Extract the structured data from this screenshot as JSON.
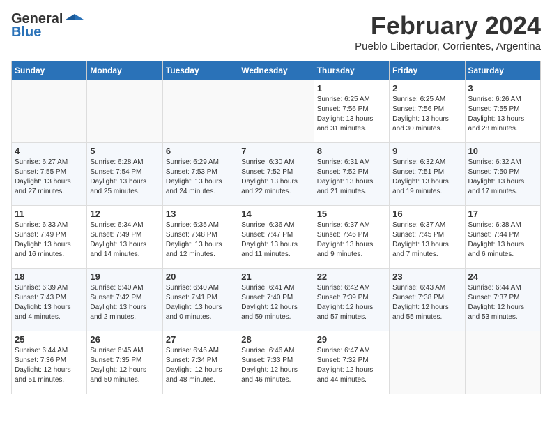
{
  "logo": {
    "general": "General",
    "blue": "Blue"
  },
  "title": {
    "month": "February 2024",
    "location": "Pueblo Libertador, Corrientes, Argentina"
  },
  "headers": [
    "Sunday",
    "Monday",
    "Tuesday",
    "Wednesday",
    "Thursday",
    "Friday",
    "Saturday"
  ],
  "weeks": [
    [
      {
        "day": "",
        "detail": ""
      },
      {
        "day": "",
        "detail": ""
      },
      {
        "day": "",
        "detail": ""
      },
      {
        "day": "",
        "detail": ""
      },
      {
        "day": "1",
        "detail": "Sunrise: 6:25 AM\nSunset: 7:56 PM\nDaylight: 13 hours\nand 31 minutes."
      },
      {
        "day": "2",
        "detail": "Sunrise: 6:25 AM\nSunset: 7:56 PM\nDaylight: 13 hours\nand 30 minutes."
      },
      {
        "day": "3",
        "detail": "Sunrise: 6:26 AM\nSunset: 7:55 PM\nDaylight: 13 hours\nand 28 minutes."
      }
    ],
    [
      {
        "day": "4",
        "detail": "Sunrise: 6:27 AM\nSunset: 7:55 PM\nDaylight: 13 hours\nand 27 minutes."
      },
      {
        "day": "5",
        "detail": "Sunrise: 6:28 AM\nSunset: 7:54 PM\nDaylight: 13 hours\nand 25 minutes."
      },
      {
        "day": "6",
        "detail": "Sunrise: 6:29 AM\nSunset: 7:53 PM\nDaylight: 13 hours\nand 24 minutes."
      },
      {
        "day": "7",
        "detail": "Sunrise: 6:30 AM\nSunset: 7:52 PM\nDaylight: 13 hours\nand 22 minutes."
      },
      {
        "day": "8",
        "detail": "Sunrise: 6:31 AM\nSunset: 7:52 PM\nDaylight: 13 hours\nand 21 minutes."
      },
      {
        "day": "9",
        "detail": "Sunrise: 6:32 AM\nSunset: 7:51 PM\nDaylight: 13 hours\nand 19 minutes."
      },
      {
        "day": "10",
        "detail": "Sunrise: 6:32 AM\nSunset: 7:50 PM\nDaylight: 13 hours\nand 17 minutes."
      }
    ],
    [
      {
        "day": "11",
        "detail": "Sunrise: 6:33 AM\nSunset: 7:49 PM\nDaylight: 13 hours\nand 16 minutes."
      },
      {
        "day": "12",
        "detail": "Sunrise: 6:34 AM\nSunset: 7:49 PM\nDaylight: 13 hours\nand 14 minutes."
      },
      {
        "day": "13",
        "detail": "Sunrise: 6:35 AM\nSunset: 7:48 PM\nDaylight: 13 hours\nand 12 minutes."
      },
      {
        "day": "14",
        "detail": "Sunrise: 6:36 AM\nSunset: 7:47 PM\nDaylight: 13 hours\nand 11 minutes."
      },
      {
        "day": "15",
        "detail": "Sunrise: 6:37 AM\nSunset: 7:46 PM\nDaylight: 13 hours\nand 9 minutes."
      },
      {
        "day": "16",
        "detail": "Sunrise: 6:37 AM\nSunset: 7:45 PM\nDaylight: 13 hours\nand 7 minutes."
      },
      {
        "day": "17",
        "detail": "Sunrise: 6:38 AM\nSunset: 7:44 PM\nDaylight: 13 hours\nand 6 minutes."
      }
    ],
    [
      {
        "day": "18",
        "detail": "Sunrise: 6:39 AM\nSunset: 7:43 PM\nDaylight: 13 hours\nand 4 minutes."
      },
      {
        "day": "19",
        "detail": "Sunrise: 6:40 AM\nSunset: 7:42 PM\nDaylight: 13 hours\nand 2 minutes."
      },
      {
        "day": "20",
        "detail": "Sunrise: 6:40 AM\nSunset: 7:41 PM\nDaylight: 13 hours\nand 0 minutes."
      },
      {
        "day": "21",
        "detail": "Sunrise: 6:41 AM\nSunset: 7:40 PM\nDaylight: 12 hours\nand 59 minutes."
      },
      {
        "day": "22",
        "detail": "Sunrise: 6:42 AM\nSunset: 7:39 PM\nDaylight: 12 hours\nand 57 minutes."
      },
      {
        "day": "23",
        "detail": "Sunrise: 6:43 AM\nSunset: 7:38 PM\nDaylight: 12 hours\nand 55 minutes."
      },
      {
        "day": "24",
        "detail": "Sunrise: 6:44 AM\nSunset: 7:37 PM\nDaylight: 12 hours\nand 53 minutes."
      }
    ],
    [
      {
        "day": "25",
        "detail": "Sunrise: 6:44 AM\nSunset: 7:36 PM\nDaylight: 12 hours\nand 51 minutes."
      },
      {
        "day": "26",
        "detail": "Sunrise: 6:45 AM\nSunset: 7:35 PM\nDaylight: 12 hours\nand 50 minutes."
      },
      {
        "day": "27",
        "detail": "Sunrise: 6:46 AM\nSunset: 7:34 PM\nDaylight: 12 hours\nand 48 minutes."
      },
      {
        "day": "28",
        "detail": "Sunrise: 6:46 AM\nSunset: 7:33 PM\nDaylight: 12 hours\nand 46 minutes."
      },
      {
        "day": "29",
        "detail": "Sunrise: 6:47 AM\nSunset: 7:32 PM\nDaylight: 12 hours\nand 44 minutes."
      },
      {
        "day": "",
        "detail": ""
      },
      {
        "day": "",
        "detail": ""
      }
    ]
  ]
}
